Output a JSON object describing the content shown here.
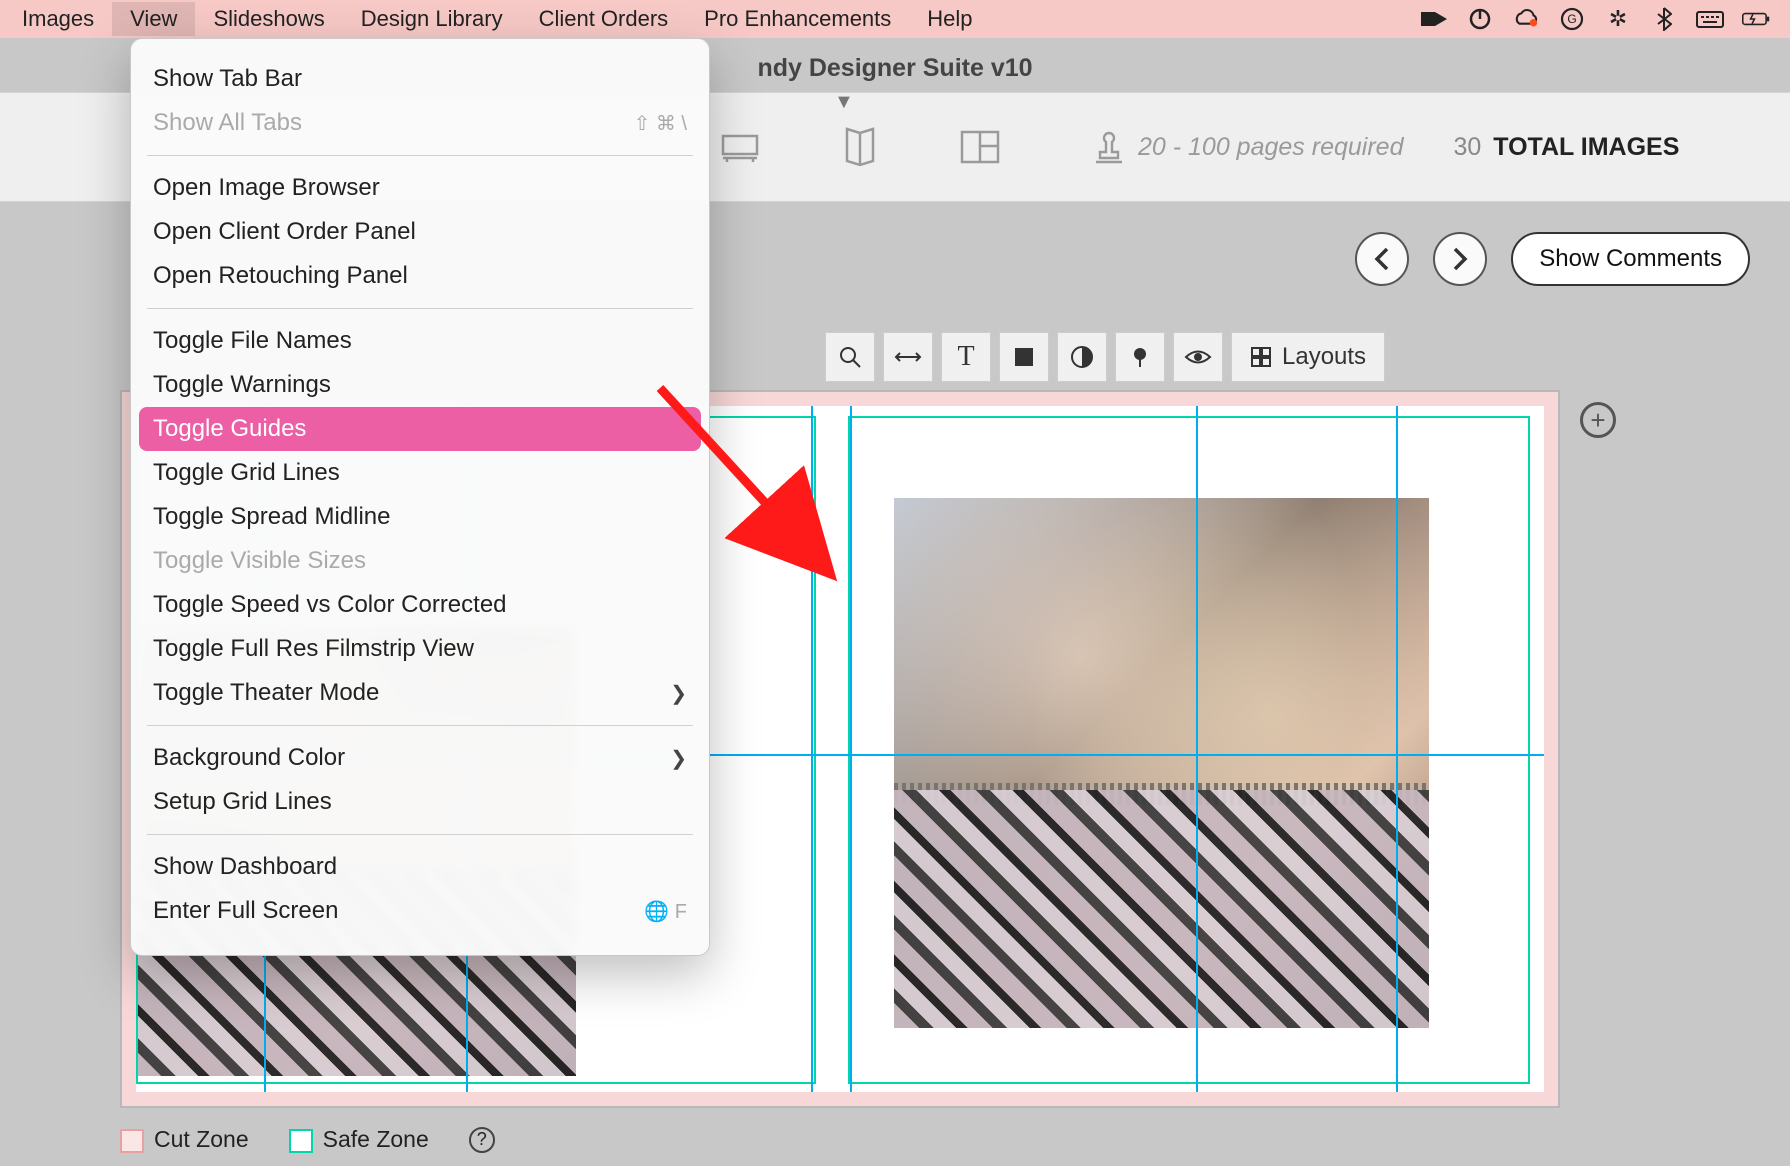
{
  "menubar": {
    "items": [
      "Images",
      "View",
      "Slideshows",
      "Design Library",
      "Client Orders",
      "Pro Enhancements",
      "Help"
    ],
    "active_index": 1
  },
  "window": {
    "title": "ndy Designer Suite v10"
  },
  "toolbar": {
    "pages_required_text": "20 - 100 pages required",
    "total_count": "30",
    "total_label": "TOTAL IMAGES"
  },
  "nav": {
    "comments_button": "Show Comments"
  },
  "toolchips": {
    "layouts_label": "Layouts"
  },
  "legend": {
    "cut_zone": "Cut Zone",
    "safe_zone": "Safe Zone"
  },
  "dropdown": {
    "items": [
      {
        "label": "Show Tab Bar",
        "type": "item"
      },
      {
        "label": "Show All Tabs",
        "type": "item",
        "disabled": true,
        "shortcut": "⇧ ⌘ \\"
      },
      {
        "type": "sep"
      },
      {
        "label": "Open Image Browser",
        "type": "item"
      },
      {
        "label": "Open Client Order Panel",
        "type": "item"
      },
      {
        "label": "Open Retouching Panel",
        "type": "item"
      },
      {
        "type": "sep"
      },
      {
        "label": "Toggle File Names",
        "type": "item"
      },
      {
        "label": "Toggle Warnings",
        "type": "item"
      },
      {
        "label": "Toggle Guides",
        "type": "item",
        "highlighted": true
      },
      {
        "label": "Toggle Grid Lines",
        "type": "item"
      },
      {
        "label": "Toggle Spread Midline",
        "type": "item"
      },
      {
        "label": "Toggle Visible Sizes",
        "type": "item",
        "disabled": true
      },
      {
        "label": "Toggle Speed vs Color Corrected",
        "type": "item"
      },
      {
        "label": "Toggle Full Res Filmstrip View",
        "type": "item"
      },
      {
        "label": "Toggle Theater Mode",
        "type": "item",
        "submenu": true
      },
      {
        "type": "sep"
      },
      {
        "label": "Background Color",
        "type": "item",
        "submenu": true
      },
      {
        "label": "Setup Grid Lines",
        "type": "item"
      },
      {
        "type": "sep"
      },
      {
        "label": "Show Dashboard",
        "type": "item"
      },
      {
        "label": "Enter Full Screen",
        "type": "item",
        "shortcut": "🌐 F"
      }
    ]
  }
}
